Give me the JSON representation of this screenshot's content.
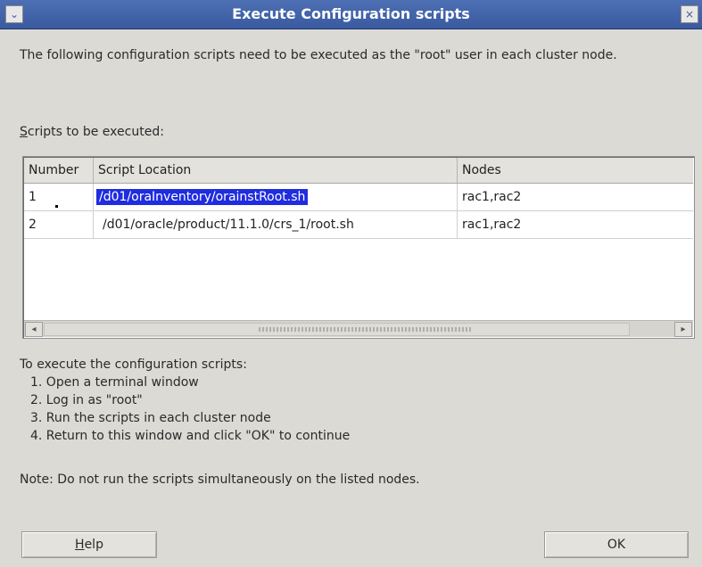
{
  "window": {
    "title": "Execute Configuration scripts",
    "menu_icon": "chevron-down-icon",
    "close_icon": "close-icon",
    "close_glyph": "×",
    "menu_glyph": "⌄"
  },
  "intro_text": "The following configuration scripts need to be executed as the \"root\" user in each cluster node.",
  "scripts_label_mnemonic": "S",
  "scripts_label_rest": "cripts to be executed:",
  "table": {
    "columns": [
      "Number",
      "Script Location",
      "Nodes"
    ],
    "rows": [
      {
        "number": "1",
        "location": "/d01/oraInventory/orainstRoot.sh",
        "nodes": "rac1,rac2"
      },
      {
        "number": "2",
        "location": "/d01/oracle/product/11.1.0/crs_1/root.sh",
        "nodes": "rac1,rac2"
      }
    ],
    "scroll_left_glyph": "◂",
    "scroll_right_glyph": "▸"
  },
  "instructions": {
    "title": "To execute the configuration scripts:",
    "steps": [
      "1.  Open a terminal window",
      "2.  Log in as \"root\"",
      "3.  Run the scripts in each cluster node",
      "4.  Return to this window and click \"OK\" to continue"
    ]
  },
  "note": "Note: Do not run the scripts simultaneously on the listed nodes.",
  "buttons": {
    "help_mnemonic": "H",
    "help_rest": "elp",
    "ok_label": "OK"
  }
}
